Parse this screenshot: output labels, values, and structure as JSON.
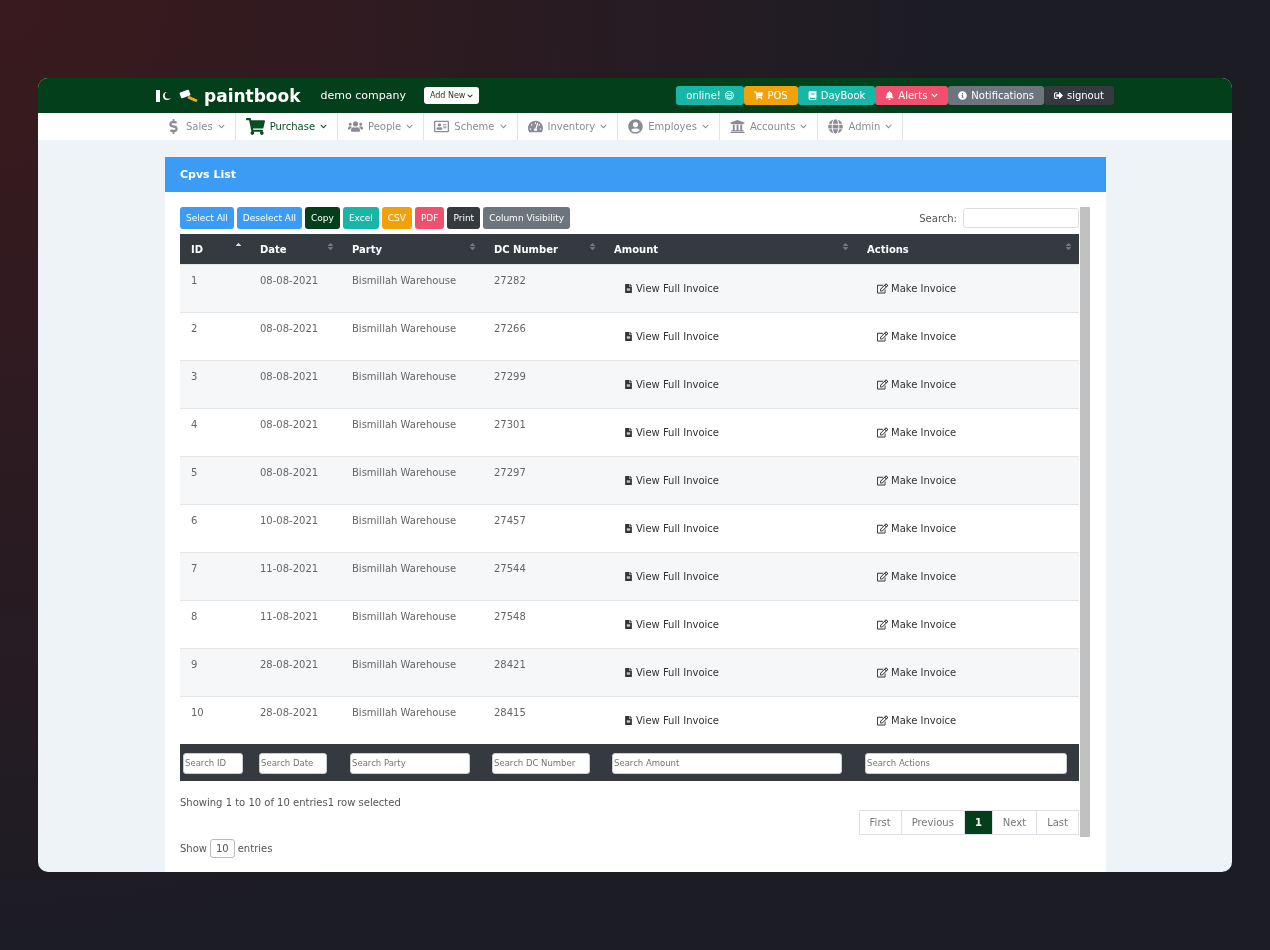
{
  "header": {
    "logo": "paintbook",
    "company": "demo company",
    "add_new": "Add New",
    "badges": [
      {
        "kind": "online",
        "label": "online! 😄",
        "color": "#17b6a6"
      },
      {
        "kind": "pos",
        "label": "POS",
        "color": "#f1a10a"
      },
      {
        "kind": "daybook",
        "label": "DayBook",
        "color": "#17b6a6"
      },
      {
        "kind": "alerts",
        "label": "Alerts",
        "color": "#f0506e"
      },
      {
        "kind": "notifications",
        "label": "Notifications",
        "color": "#6c757d"
      },
      {
        "kind": "signout",
        "label": "signout",
        "color": "#343a40"
      }
    ]
  },
  "nav": [
    {
      "kind": "sales",
      "label": "Sales",
      "selected": false
    },
    {
      "kind": "purchase",
      "label": "Purchase",
      "selected": true
    },
    {
      "kind": "people",
      "label": "People",
      "selected": false
    },
    {
      "kind": "scheme",
      "label": "Scheme",
      "selected": false
    },
    {
      "kind": "inventory",
      "label": "Inventory",
      "selected": false
    },
    {
      "kind": "employees",
      "label": "Employes",
      "selected": false
    },
    {
      "kind": "accounts",
      "label": "Accounts",
      "selected": false
    },
    {
      "kind": "admin",
      "label": "Admin",
      "selected": false
    }
  ],
  "card": {
    "title": "Cpvs List"
  },
  "toolbar": [
    {
      "label": "Select All",
      "color": "#3c9cf5"
    },
    {
      "label": "Deselect All",
      "color": "#3c9cf5"
    },
    {
      "label": "Copy",
      "color": "#033f1b"
    },
    {
      "label": "Excel",
      "color": "#17b6a6"
    },
    {
      "label": "CSV",
      "color": "#f1a10a"
    },
    {
      "label": "PDF",
      "color": "#f0506e"
    },
    {
      "label": "Print",
      "color": "#343a40"
    },
    {
      "label": "Column Visibility",
      "color": "#6c757d"
    }
  ],
  "search_label": "Search:",
  "table": {
    "columns": [
      {
        "label": "ID",
        "sorted": true
      },
      {
        "label": "Date",
        "sorted": false
      },
      {
        "label": "Party",
        "sorted": false
      },
      {
        "label": "DC Number",
        "sorted": false
      },
      {
        "label": "Amount",
        "sorted": false
      },
      {
        "label": "Actions",
        "sorted": false
      }
    ],
    "rows": [
      {
        "id": "1",
        "date": "08-08-2021",
        "party": "Bismillah Warehouse",
        "dc": "27282",
        "view": "View Full Invoice",
        "make": "Make Invoice"
      },
      {
        "id": "2",
        "date": "08-08-2021",
        "party": "Bismillah Warehouse",
        "dc": "27266",
        "view": "View Full Invoice",
        "make": "Make Invoice"
      },
      {
        "id": "3",
        "date": "08-08-2021",
        "party": "Bismillah Warehouse",
        "dc": "27299",
        "view": "View Full Invoice",
        "make": "Make Invoice"
      },
      {
        "id": "4",
        "date": "08-08-2021",
        "party": "Bismillah Warehouse",
        "dc": "27301",
        "view": "View Full Invoice",
        "make": "Make Invoice"
      },
      {
        "id": "5",
        "date": "08-08-2021",
        "party": "Bismillah Warehouse",
        "dc": "27297",
        "view": "View Full Invoice",
        "make": "Make Invoice"
      },
      {
        "id": "6",
        "date": "10-08-2021",
        "party": "Bismillah Warehouse",
        "dc": "27457",
        "view": "View Full Invoice",
        "make": "Make Invoice"
      },
      {
        "id": "7",
        "date": "11-08-2021",
        "party": "Bismillah Warehouse",
        "dc": "27544",
        "view": "View Full Invoice",
        "make": "Make Invoice"
      },
      {
        "id": "8",
        "date": "11-08-2021",
        "party": "Bismillah Warehouse",
        "dc": "27548",
        "view": "View Full Invoice",
        "make": "Make Invoice"
      },
      {
        "id": "9",
        "date": "28-08-2021",
        "party": "Bismillah Warehouse",
        "dc": "28421",
        "view": "View Full Invoice",
        "make": "Make Invoice"
      },
      {
        "id": "10",
        "date": "28-08-2021",
        "party": "Bismillah Warehouse",
        "dc": "28415",
        "view": "View Full Invoice",
        "make": "Make Invoice"
      }
    ],
    "filters": [
      {
        "placeholder": "Search ID"
      },
      {
        "placeholder": "Search Date"
      },
      {
        "placeholder": "Search Party"
      },
      {
        "placeholder": "Search DC Number"
      },
      {
        "placeholder": "Search Amount"
      },
      {
        "placeholder": "Search Actions"
      }
    ]
  },
  "info": "Showing 1 to 10 of 10 entries1 row selected",
  "pagination": [
    {
      "label": "First",
      "selected": false
    },
    {
      "label": "Previous",
      "selected": false
    },
    {
      "label": "1",
      "selected": true
    },
    {
      "label": "Next",
      "selected": false
    },
    {
      "label": "Last",
      "selected": false
    }
  ],
  "length": {
    "before": "Show",
    "value": "10",
    "after": "entries"
  }
}
